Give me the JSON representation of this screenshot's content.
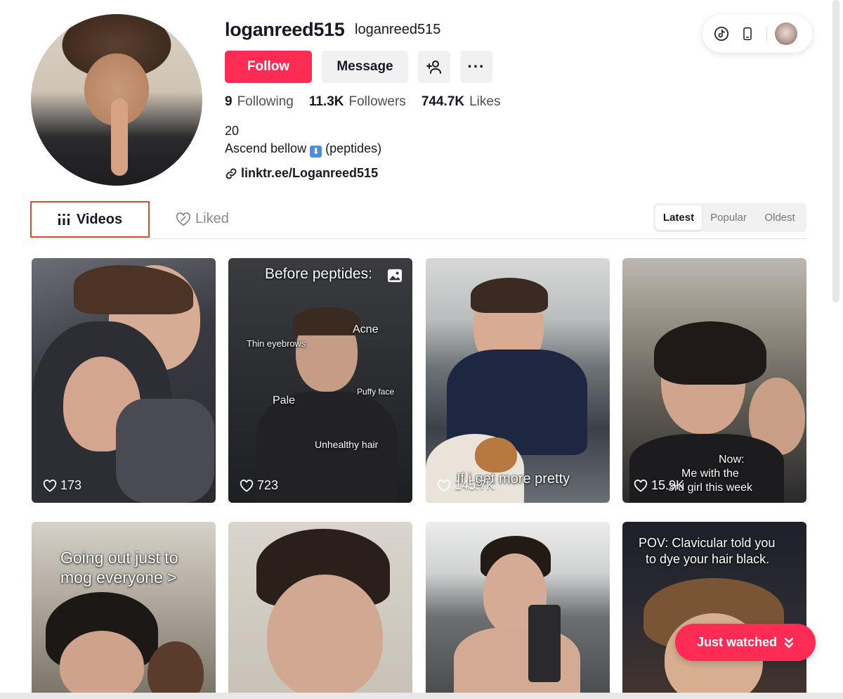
{
  "profile": {
    "username": "loganreed515",
    "nickname": "loganreed515",
    "follow_label": "Follow",
    "message_label": "Message",
    "stats": [
      {
        "value": "9",
        "label": "Following"
      },
      {
        "value": "11.3K",
        "label": "Followers"
      },
      {
        "value": "744.7K",
        "label": "Likes"
      }
    ],
    "bio_line1": "20",
    "bio_line2_pre": "Ascend bellow",
    "bio_line2_emoji": "⬇",
    "bio_line2_post": "(peptides)",
    "link": "linktr.ee/Loganreed515"
  },
  "tabs": {
    "videos": "Videos",
    "liked": "Liked"
  },
  "sort": {
    "latest": "Latest",
    "popular": "Popular",
    "oldest": "Oldest"
  },
  "videos": [
    {
      "likes": "173",
      "overlay": ""
    },
    {
      "likes": "723",
      "overlay": "Before peptides:",
      "notes": [
        "Acne",
        "Thin eyebrows",
        "Puffy face",
        "Pale",
        "Unhealthy hair"
      ]
    },
    {
      "likes": "145.7K",
      "overlay": "If i get more pretty"
    },
    {
      "likes": "15.9K",
      "overlay_lines": [
        "Now:",
        "Me with the",
        "3rd girl this week"
      ]
    },
    {
      "overlay_lines": [
        "Going out just to",
        "mog everyone >"
      ]
    },
    {
      "overlay": ""
    },
    {
      "overlay": ""
    },
    {
      "overlay_lines": [
        "POV: Clavicular told you",
        "to dye your hair black."
      ]
    }
  ],
  "floating": {
    "just_watched": "Just watched"
  },
  "colors": {
    "accent": "#fe2c55",
    "tab_highlight": "#e5472d"
  }
}
